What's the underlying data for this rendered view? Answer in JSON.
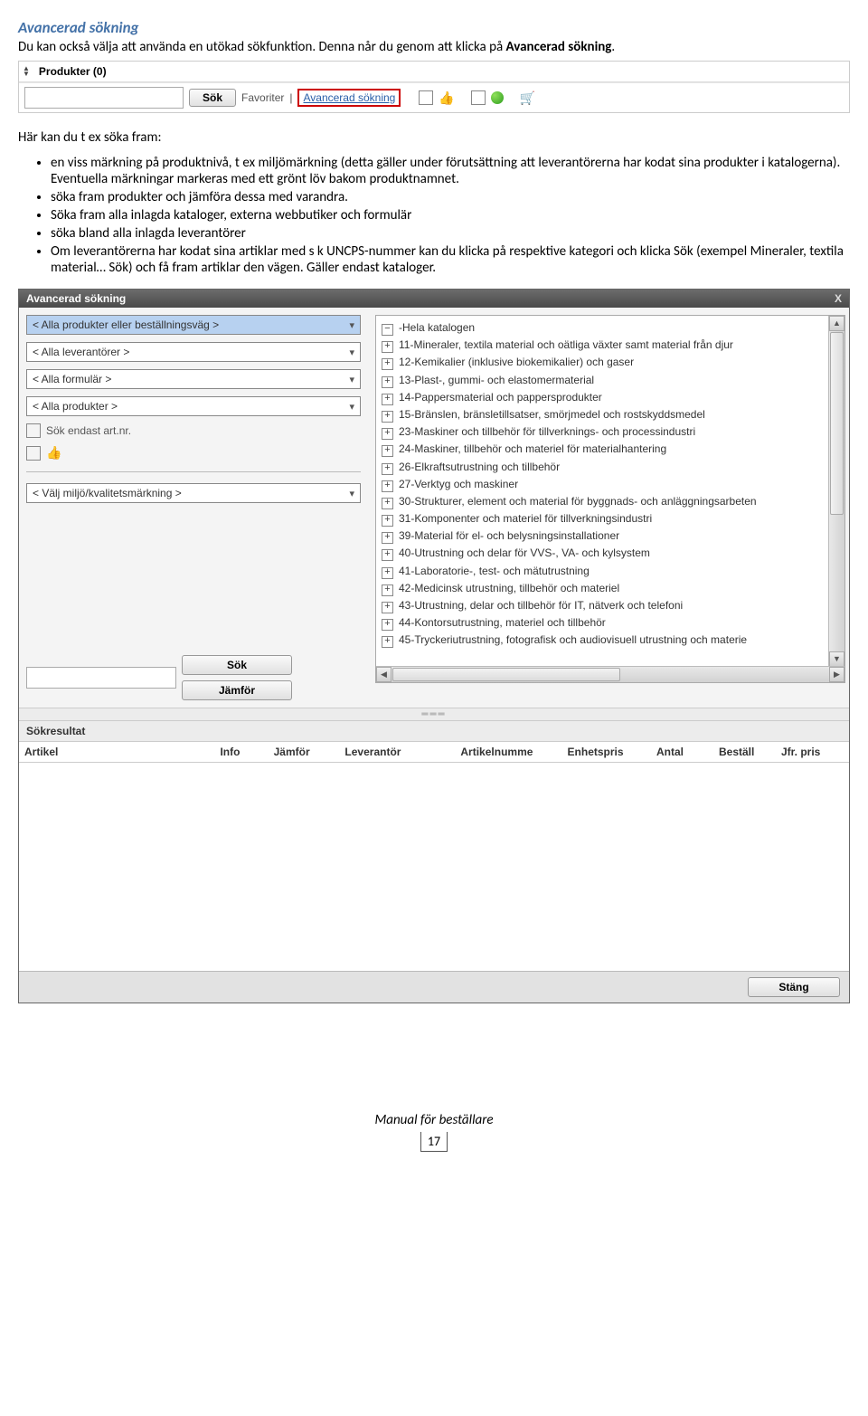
{
  "heading": "Avancerad sökning",
  "intro_1a": "Du kan också välja att använda en utökad sökfunktion. Denna når du genom att klicka på ",
  "intro_1b_bold": "Avancerad sökning",
  "intro_1c": ".",
  "toolbar": {
    "tab_label": "Produkter (0)",
    "search_btn": "Sök",
    "link_favoriter": "Favoriter",
    "sep": " | ",
    "link_avancerad": "Avancerad sökning"
  },
  "para2": "Här kan du t ex söka fram:",
  "bullets": [
    "en viss märkning på produktnivå, t ex miljömärkning (detta gäller under förutsättning att leverantörerna har kodat sina produkter i katalogerna). Eventuella märkningar markeras med ett grönt löv bakom produktnamnet.",
    "söka fram produkter och jämföra dessa med varandra.",
    "Söka fram alla inlagda kataloger, externa webbutiker och formulär",
    "söka bland alla inlagda leverantörer",
    "Om leverantörerna har kodat sina artiklar med s k UNCPS-nummer kan du klicka på respektive kategori och klicka Sök (exempel Mineraler, textila material… Sök) och få fram artiklar den vägen. Gäller endast kataloger."
  ],
  "dialog": {
    "title": "Avancerad sökning",
    "close": "X",
    "combos": [
      "< Alla produkter eller beställningsväg >",
      "< Alla leverantörer >",
      "< Alla formulär >",
      "< Alla produkter >"
    ],
    "chk_artnr": "Sök endast art.nr.",
    "combo_miljo": "< Välj miljö/kvalitetsmärkning >",
    "btn_sok": "Sök",
    "btn_jamfor": "Jämför",
    "tree": [
      {
        "sym": "⊟",
        "text": "-Hela katalogen"
      },
      {
        "sym": "⊞",
        "text": "11-Mineraler, textila material och oätliga växter samt material från djur"
      },
      {
        "sym": "⊞",
        "text": "12-Kemikalier (inklusive biokemikalier) och gaser"
      },
      {
        "sym": "⊞",
        "text": "13-Plast-, gummi- och elastomermaterial"
      },
      {
        "sym": "⊞",
        "text": "14-Pappersmaterial och pappersprodukter"
      },
      {
        "sym": "⊞",
        "text": "15-Bränslen, bränsletillsatser, smörjmedel och rostskyddsmedel"
      },
      {
        "sym": "⊞",
        "text": "23-Maskiner och tillbehör för tillverknings- och processindustri"
      },
      {
        "sym": "⊞",
        "text": "24-Maskiner, tillbehör och materiel för materialhantering"
      },
      {
        "sym": "⊞",
        "text": "26-Elkraftsutrustning och tillbehör"
      },
      {
        "sym": "⊞",
        "text": "27-Verktyg och maskiner"
      },
      {
        "sym": "⊞",
        "text": "30-Strukturer, element och material för byggnads- och anläggningsarbeten"
      },
      {
        "sym": "⊞",
        "text": "31-Komponenter och materiel för tillverkningsindustri"
      },
      {
        "sym": "⊞",
        "text": "39-Material för el- och belysningsinstallationer"
      },
      {
        "sym": "⊞",
        "text": "40-Utrustning och delar för VVS-, VA- och kylsystem"
      },
      {
        "sym": "⊞",
        "text": "41-Laboratorie-, test- och mätutrustning"
      },
      {
        "sym": "⊞",
        "text": "42-Medicinsk utrustning, tillbehör och materiel"
      },
      {
        "sym": "⊞",
        "text": "43-Utrustning, delar och tillbehör för IT, nätverk och telefoni"
      },
      {
        "sym": "⊞",
        "text": "44-Kontorsutrustning, materiel och tillbehör"
      },
      {
        "sym": "⊞",
        "text": "45-Tryckeriutrustning, fotografisk och audiovisuell utrustning och materie"
      }
    ],
    "results_label": "Sökresultat",
    "columns": [
      "Artikel",
      "Info",
      "Jämför",
      "Leverantör",
      "Artikelnumme",
      "Enhetspris",
      "Antal",
      "Beställ",
      "Jfr. pris"
    ],
    "btn_stang": "Stäng"
  },
  "footer_text": "Manual för beställare",
  "page_num": "17"
}
